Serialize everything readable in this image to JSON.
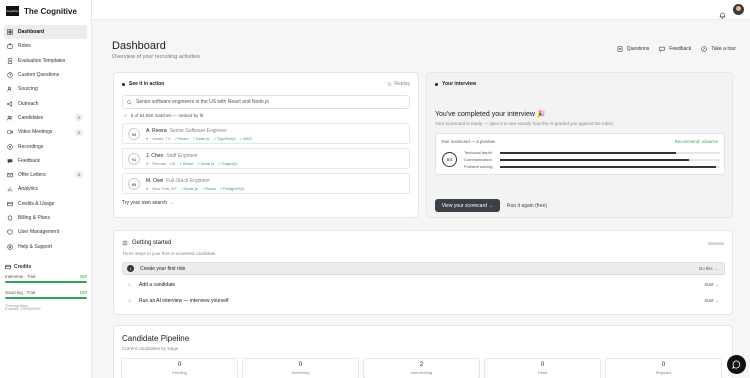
{
  "brand": {
    "logo_text": "Cognitive",
    "name": "The Cognitive"
  },
  "sidebar": {
    "items": [
      {
        "label": "Dashboard",
        "icon": "dashboard-icon",
        "active": true
      },
      {
        "label": "Roles",
        "icon": "briefcase-icon"
      },
      {
        "label": "Evaluation Templates",
        "icon": "document-icon"
      },
      {
        "label": "Custom Questions",
        "icon": "question-icon"
      },
      {
        "label": "Sourcing",
        "icon": "person-search-icon"
      },
      {
        "label": "Outreach",
        "icon": "megaphone-icon"
      },
      {
        "label": "Candidates",
        "icon": "users-icon",
        "badge": "2"
      },
      {
        "label": "Video Meetings",
        "icon": "video-icon",
        "badge": "2"
      },
      {
        "label": "Recordings",
        "icon": "recording-icon"
      },
      {
        "label": "Feedback",
        "icon": "feedback-icon"
      },
      {
        "label": "Offer Letters",
        "icon": "letter-icon",
        "badge": "0"
      },
      {
        "label": "Analytics",
        "icon": "chart-icon"
      },
      {
        "label": "Credits & Usage",
        "icon": "credit-card-icon"
      },
      {
        "label": "Billing & Plans",
        "icon": "billing-icon"
      },
      {
        "label": "User Management",
        "icon": "shield-icon"
      },
      {
        "label": "Help & Support",
        "icon": "help-icon"
      }
    ],
    "credits": {
      "title": "Credits",
      "interview_label": "Interview · Trial",
      "interview_value": "250",
      "interview_fill": 1.0,
      "sourcing_label": "Sourcing · Trial",
      "sourcing_value": "100",
      "sourcing_fill": 1.0,
      "org": "Thecognitive",
      "expires": "Expires: 29/08/2026"
    }
  },
  "header": {
    "title": "Dashboard",
    "subtitle": "Overview of your recruiting activities",
    "actions": [
      {
        "label": "Questions",
        "icon": "questions-icon"
      },
      {
        "label": "Feedback",
        "icon": "feedback-icon"
      },
      {
        "label": "Take a tour",
        "icon": "tour-icon"
      }
    ]
  },
  "see_in_action": {
    "title": "See it in action",
    "replay": "Replay",
    "search_text": "Senior software engineers in the US with React and Node.js",
    "matches": "5 of 84,650 matches — ranked by fit",
    "candidates": [
      {
        "score": "94",
        "name": "A. Rivera",
        "role": "Senior Software Engineer",
        "location": "Austin, TX",
        "tags": [
          "React",
          "Node.js",
          "TypeScript",
          "AWS"
        ]
      },
      {
        "score": "91",
        "name": "J. Chen",
        "role": "Staff Engineer",
        "location": "Remote · US",
        "tags": [
          "React",
          "Node.js",
          "GraphQL"
        ]
      },
      {
        "score": "89",
        "name": "M. Osei",
        "role": "Full-Stack Engineer",
        "location": "New York, NY",
        "tags": [
          "Node.js",
          "React",
          "PostgreSQL"
        ]
      }
    ],
    "own_search": "Try your own search →"
  },
  "your_interview": {
    "title": "Your interview",
    "done_title": "You've completed your interview 🎉",
    "done_sub": "Your scorecard is ready — open it to see exactly how the AI graded you against the rubric.",
    "preview_title": "Your scorecard — a preview",
    "recommendation": "Recommend: Advance",
    "score": "84",
    "metrics": [
      {
        "label": "Technical depth",
        "value": 0.8
      },
      {
        "label": "Communication",
        "value": 0.86
      },
      {
        "label": "Problem solving",
        "value": 0.98
      }
    ],
    "view_button": "View your scorecard →",
    "run_again": "Run it again (free)"
  },
  "getting_started": {
    "title": "Getting started",
    "dismiss": "Dismiss",
    "subtitle": "Three steps to your first AI-screened candidate.",
    "steps": [
      {
        "num": "1",
        "label": "Create your first role",
        "action": "Do this →"
      },
      {
        "num": "2",
        "label": "Add a candidate",
        "action": "Start →"
      },
      {
        "num": "3",
        "label": "Run an AI interview — interview yourself",
        "action": "Start →"
      }
    ]
  },
  "pipeline": {
    "title": "Candidate Pipeline",
    "subtitle": "Current candidates by stage",
    "stages": [
      {
        "value": "0",
        "label": "Pending"
      },
      {
        "value": "0",
        "label": "Screening"
      },
      {
        "value": "2",
        "label": "Interviewing"
      },
      {
        "value": "0",
        "label": "Hired"
      },
      {
        "value": "0",
        "label": "Rejected"
      }
    ]
  }
}
